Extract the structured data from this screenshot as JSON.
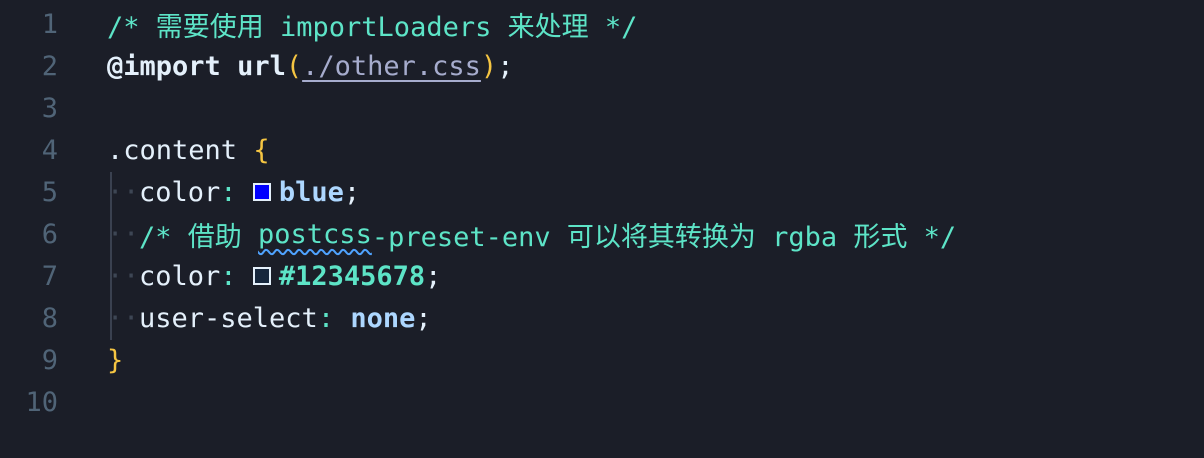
{
  "editor": {
    "line_numbers": [
      "1",
      "2",
      "3",
      "4",
      "5",
      "6",
      "7",
      "8",
      "9",
      "10"
    ],
    "line1": {
      "comment": "/* 需要使用 importLoaders 来处理 */"
    },
    "line2": {
      "at_rule": "@import",
      "fn": "url",
      "open_paren": "(",
      "url": "./other.css",
      "close_paren": ")",
      "semicolon": ";"
    },
    "line4": {
      "selector": ".content",
      "brace_open": "{"
    },
    "line5": {
      "property": "color",
      "colon": ":",
      "swatch_color": "#0000ff",
      "value": "blue",
      "semicolon": ";"
    },
    "line6": {
      "comment_start": "/* 借助 ",
      "comment_squiggle": "postcss",
      "comment_end": "-preset-env 可以将其转换为 rgba 形式 */"
    },
    "line7": {
      "property": "color",
      "colon": ":",
      "swatch_color": "#12345678",
      "value": "#12345678",
      "semicolon": ";"
    },
    "line8": {
      "property": "user-select",
      "colon": ":",
      "value": "none",
      "semicolon": ";"
    },
    "line9": {
      "brace_close": "}"
    }
  },
  "colors": {
    "background": "#1b1e28",
    "line_number": "#506477",
    "comment": "#5de4c7",
    "brace": "#f5c542"
  }
}
